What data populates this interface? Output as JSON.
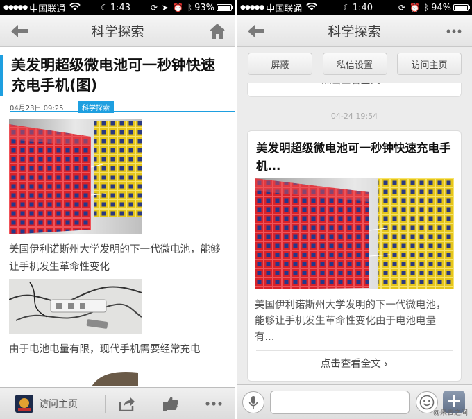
{
  "left": {
    "status": {
      "carrier": "中国联通",
      "time": "1:43",
      "battery": "93%",
      "battery_fraction": 0.93
    },
    "nav": {
      "title": "科学探索",
      "back_icon": "back-arrow-icon",
      "home_icon": "home-icon"
    },
    "article": {
      "title": "美发明超级微电池可一秒钟快速充电手机(图)",
      "date": "04月23日 09:25",
      "category": "科学探索",
      "paragraph1": "美国伊利诺斯州大学发明的下一代微电池，能够让手机发生革命性变化",
      "paragraph2": "由于电池电量有限，现代手机需要经常充电"
    },
    "toolbar": {
      "visit_label": "访问主页",
      "share_icon": "share-icon",
      "like_icon": "thumbs-up-icon",
      "more_icon": "more-dots-icon"
    },
    "watermark": "@来去之间"
  },
  "right": {
    "status": {
      "carrier": "中国联通",
      "time": "1:40",
      "battery": "94%",
      "battery_fraction": 0.94
    },
    "nav": {
      "title": "科学探索",
      "back_icon": "back-arrow-icon",
      "more_icon": "more-dots-icon"
    },
    "actions": {
      "block": "屏蔽",
      "dm_settings": "私信设置",
      "visit": "访问主页"
    },
    "prev_card_link": "点击查看全文",
    "timestamp": "04-24 19:54",
    "card": {
      "title": "美发明超级微电池可一秒钟快速充电手机...",
      "excerpt": "美国伊利诺斯州大学发明的下一代微电池，能够让手机发生革命性变化由于电池电量有...",
      "link": "点击查看全文"
    },
    "input": {
      "placeholder": "",
      "voice_icon": "microphone-icon",
      "emoji_icon": "emoji-icon",
      "plus_icon": "plus-icon"
    },
    "watermark": "@来去之间"
  }
}
